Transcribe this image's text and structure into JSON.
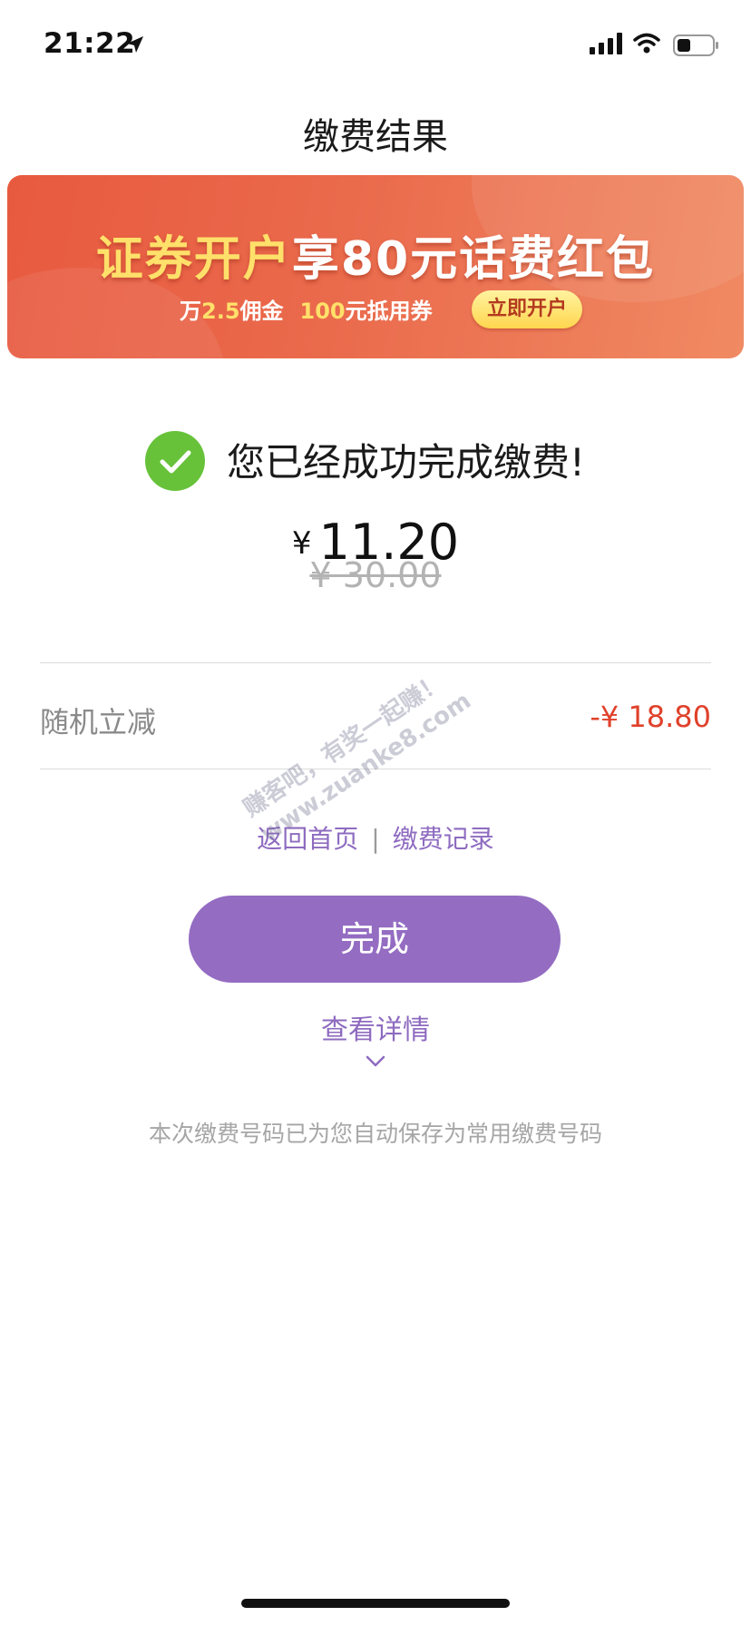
{
  "status_bar": {
    "time": "21:22",
    "icons": [
      "location-arrow-icon",
      "cellular-signal-icon",
      "wifi-icon",
      "battery-icon"
    ]
  },
  "nav": {
    "title": "缴费结果"
  },
  "banner": {
    "title_highlight": "证券开户",
    "title_rest": "享80元话费红包",
    "sub_prefix": "万",
    "sub_rate": "2.5",
    "sub_mid": "佣金",
    "sub_amount": "100",
    "sub_suffix": "元抵用券",
    "cta": "立即开户"
  },
  "result": {
    "message": "您已经成功完成缴费!",
    "currency": "¥",
    "amount": "11.20",
    "original": "¥ 30.00"
  },
  "discount": {
    "label": "随机立减",
    "value": "-¥ 18.80"
  },
  "links": {
    "home": "返回首页",
    "separator": "|",
    "records": "缴费记录"
  },
  "done_button": "完成",
  "detail_link": "查看详情",
  "note": "本次缴费号码已为您自动保存为常用缴费号码",
  "watermark": {
    "line1": "赚客吧，有奖一起赚！",
    "line2": "www.zuanke8.com"
  },
  "colors": {
    "accent": "#946cc2",
    "success": "#67c23a",
    "discount": "#e0412b",
    "banner": "#e85a40"
  }
}
